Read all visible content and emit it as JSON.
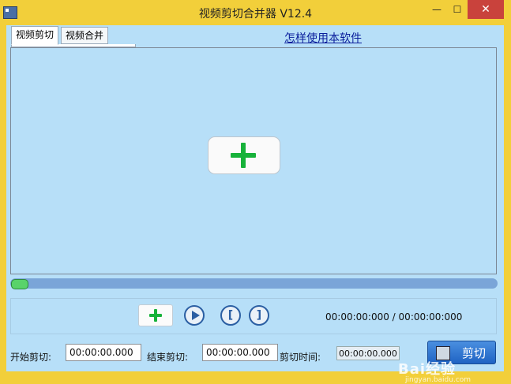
{
  "window": {
    "title": "视频剪切合并器 V12.4",
    "min": "—",
    "max": "☐",
    "close": "✕"
  },
  "tabs": [
    {
      "label": "视频剪切",
      "active": true
    },
    {
      "label": "视频合并",
      "active": false
    }
  ],
  "help_link": "怎样使用本软件",
  "player": {
    "progress": 0.0
  },
  "controls": {
    "time_current": "00:00:00:000",
    "time_separator": "/",
    "time_total": "00:00:00:000",
    "mark_in": "[",
    "mark_out": "]"
  },
  "fields": {
    "start_label": "开始剪切:",
    "start_value": "00:00:00.000",
    "end_label": "结束剪切:",
    "end_value": "00:00:00.000",
    "duration_label": "剪切时间:",
    "duration_value": "00:00:00.000"
  },
  "cut_button": "剪切",
  "watermark": {
    "text": "Bai经验",
    "sub": "jingyan.baidu.com"
  },
  "colors": {
    "title_bar": "#f2cf3a",
    "client_bg": "#b7dff8",
    "progress_track": "#7aa5d8",
    "progress_thumb": "#59d36a",
    "plus_green": "#17b23a",
    "cut_button": "#1f63c3",
    "link": "#0a1e9c"
  }
}
